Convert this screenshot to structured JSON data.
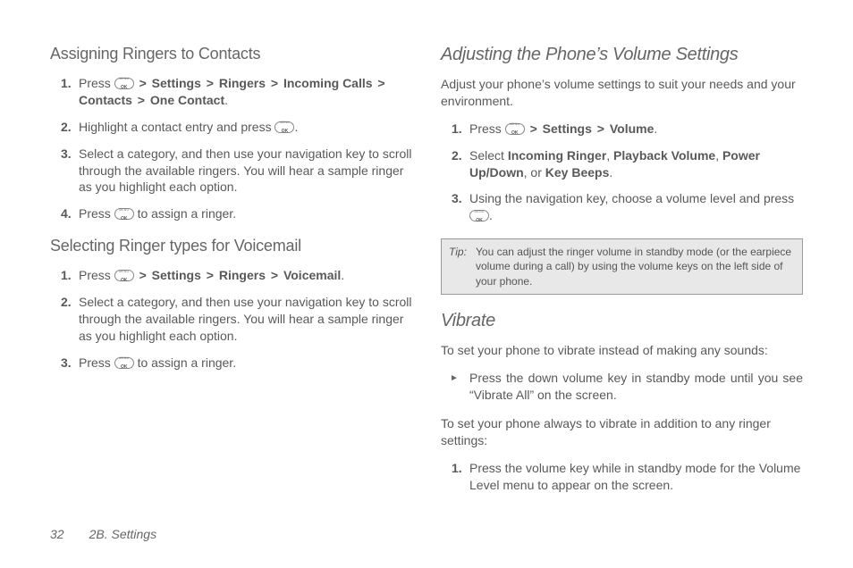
{
  "left": {
    "h_assign": "Assigning Ringers to Contacts",
    "assign_steps": {
      "s1_a": "Press ",
      "s1_b": "Settings",
      "s1_c": "Ringers",
      "s1_d": "Incoming Calls",
      "s1_e": "Contacts",
      "s1_f": "One Contact",
      "s2_a": "Highlight a contact entry and press ",
      "s3": "Select a category, and then use your navigation key to scroll through the available ringers. You will hear a sample ringer as you highlight each option.",
      "s4_a": "Press ",
      "s4_b": " to assign a ringer."
    },
    "h_voicemail": "Selecting Ringer types for Voicemail",
    "vm_steps": {
      "s1_a": "Press ",
      "s1_b": "Settings",
      "s1_c": "Ringers",
      "s1_d": "Voicemail",
      "s2": "Select a category, and then use your navigation key to scroll through the available ringers. You will hear a sample ringer as you highlight each option.",
      "s3_a": "Press ",
      "s3_b": " to assign a ringer."
    }
  },
  "right": {
    "h_volume": "Adjusting the Phone’s Volume Settings",
    "vol_intro": "Adjust your phone’s volume settings to suit your needs and your environment.",
    "vol_steps": {
      "s1_a": "Press ",
      "s1_b": "Settings",
      "s1_c": "Volume",
      "s2_a": "Select ",
      "s2_b": "Incoming Ringer",
      "s2_c": "Playback Volume",
      "s2_d": "Power Up/Down",
      "s2_e": "Key Beeps",
      "s3_a": "Using the navigation key, choose a volume level and press "
    },
    "tip_label": "Tip:",
    "tip_body": "You can adjust the ringer volume in standby mode (or the earpiece volume during a call) by using the volume keys on the left side of your phone.",
    "h_vibrate": "Vibrate",
    "vib_intro1": "To set your phone to vibrate instead of making any sounds:",
    "vib_bullet": "Press the down volume key in standby mode until you see “Vibrate All” on the screen.",
    "vib_intro2": "To set your phone always to vibrate in addition to any ringer settings:",
    "vib_step1": "Press the volume key while in standby mode for the Volume Level menu to appear on the screen."
  },
  "footer": {
    "page": "32",
    "section": "2B. Settings"
  },
  "glyphs": {
    "gt": ">",
    "sep_comma": ", ",
    "sep_or": ", or ",
    "period": "."
  }
}
